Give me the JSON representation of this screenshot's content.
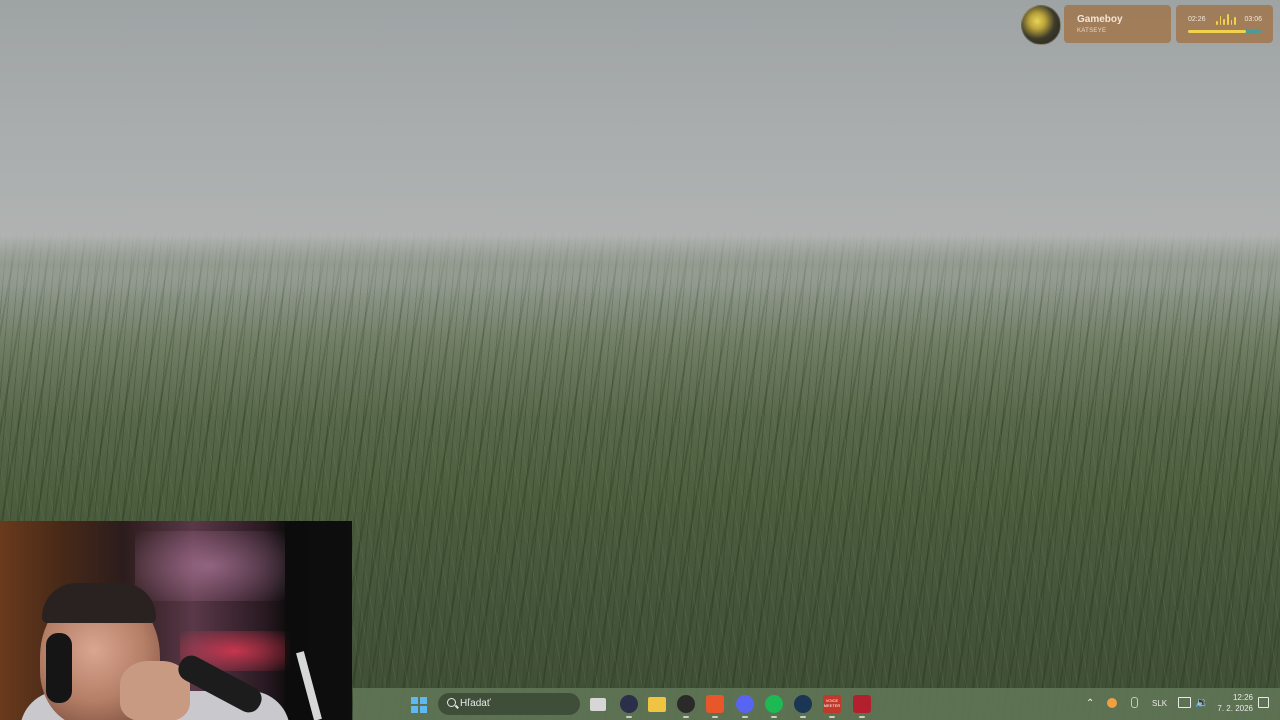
{
  "desktop": {
    "wallpaper": "foggy grass field"
  },
  "media_widget": {
    "track_title": "Gameboy",
    "artist": "KATSEYE",
    "time_current": "02:26",
    "time_total": "03:06",
    "progress": 0.79,
    "accent": "#f2d24a",
    "card_color": "#a07850"
  },
  "taskbar": {
    "search_label": "Hľadať",
    "apps": [
      {
        "name": "file-explorer-window-icon"
      },
      {
        "name": "obs-icon"
      },
      {
        "name": "folder-icon"
      },
      {
        "name": "recorder-icon"
      },
      {
        "name": "brave-browser-icon"
      },
      {
        "name": "discord-icon"
      },
      {
        "name": "spotify-icon"
      },
      {
        "name": "steam-icon"
      },
      {
        "name": "voicemeeter-icon",
        "text": "VOICE\nMEETER"
      },
      {
        "name": "red-app-icon"
      }
    ],
    "tray": {
      "language": "SLK",
      "time": "12:26",
      "date": "7. 2. 2026"
    }
  }
}
